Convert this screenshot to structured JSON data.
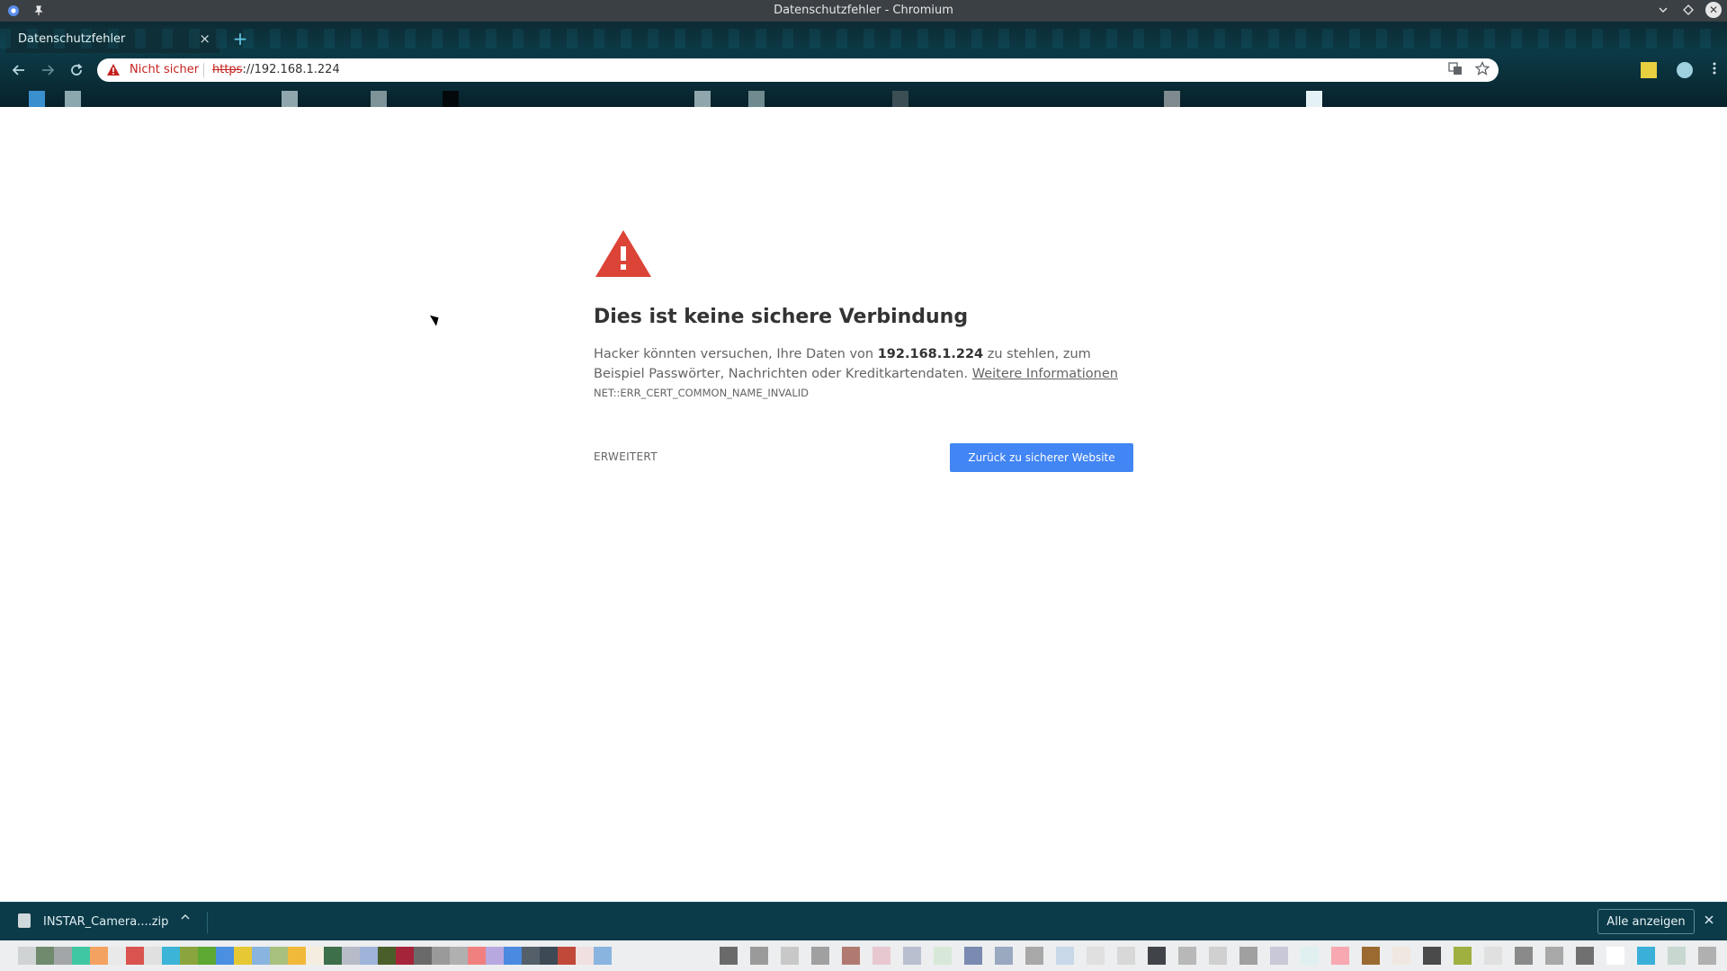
{
  "window": {
    "title": "Datenschutzfehler - Chromium",
    "icons": [
      "chromium-icon",
      "pin-icon",
      "minimize-icon",
      "maximize-icon",
      "close-icon"
    ]
  },
  "tab": {
    "label": "Datenschutzfehler",
    "close": "×",
    "new_tab": "+"
  },
  "omnibox": {
    "security_label": "Nicht sicher",
    "url_scheme": "https",
    "url_rest": "://192.168.1.224"
  },
  "interstitial": {
    "heading": "Dies ist keine sichere Verbindung",
    "para_before": "Hacker könnten versuchen, Ihre Daten von ",
    "host": "192.168.1.224",
    "para_after": " zu stehlen, zum Beispiel Passwörter, Nachrichten oder Kreditkartendaten. ",
    "learn_more": "Weitere Informationen",
    "error_code": "NET::ERR_CERT_COMMON_NAME_INVALID",
    "advanced_label": "ERWEITERT",
    "back_label": "Zurück zu sicherer Website"
  },
  "download_shelf": {
    "file_name": "INSTAR_Camera....zip",
    "show_all_label": "Alle anzeigen"
  },
  "colors": {
    "danger": "#c5221f",
    "primary": "#4285f4",
    "titlebar": "#3b4045",
    "shelf": "#0b3a48"
  }
}
